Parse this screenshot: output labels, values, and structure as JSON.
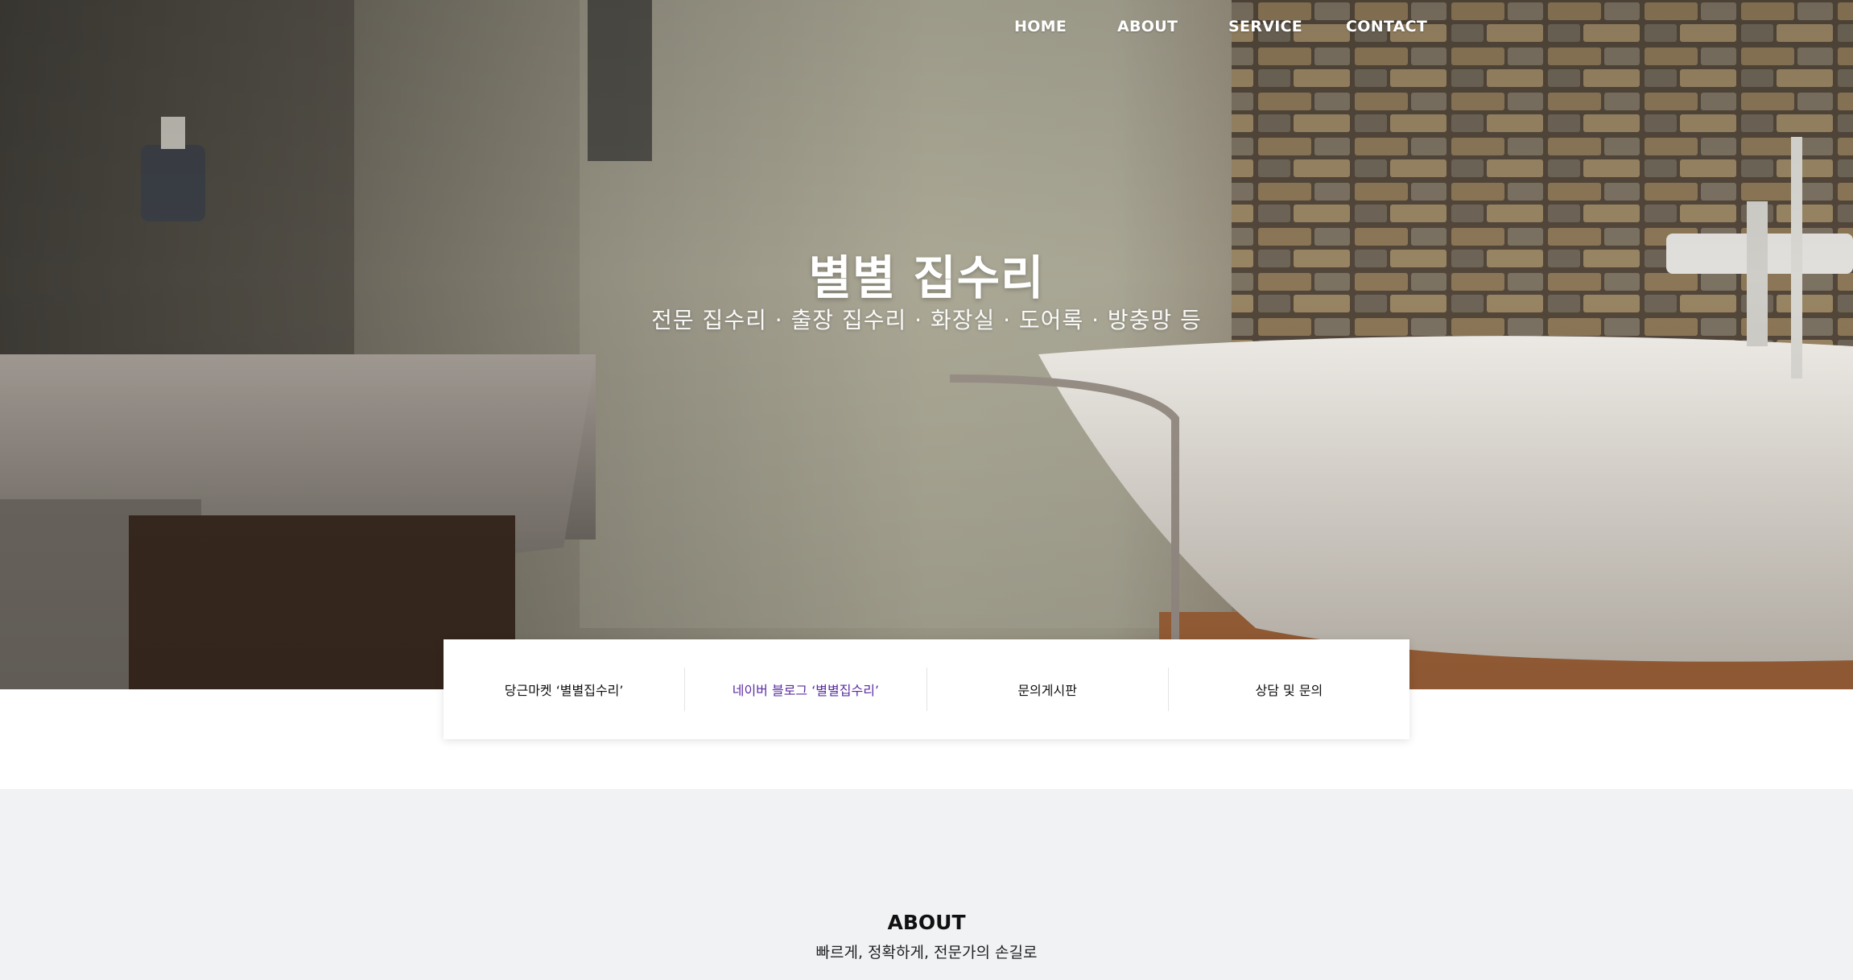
{
  "nav": {
    "items": [
      "HOME",
      "ABOUT",
      "SERVICE",
      "CONTACT"
    ]
  },
  "hero": {
    "title": "별별 집수리",
    "subtitle": "전문 집수리 · 출장 집수리 · 화장실 · 도어록 · 방충망 등"
  },
  "quick_links": {
    "items": [
      "당근마켓 ‘별별집수리’",
      "네이버 블로그 ‘별별집수리’",
      "문의게시판",
      "상담 및 문의"
    ]
  },
  "about": {
    "title": "ABOUT",
    "subtitle": "빠르게, 정확하게, 전문가의 손길로"
  },
  "colors": {
    "visited_link": "#5a2ca0",
    "about_bg": "#f1f2f4"
  }
}
